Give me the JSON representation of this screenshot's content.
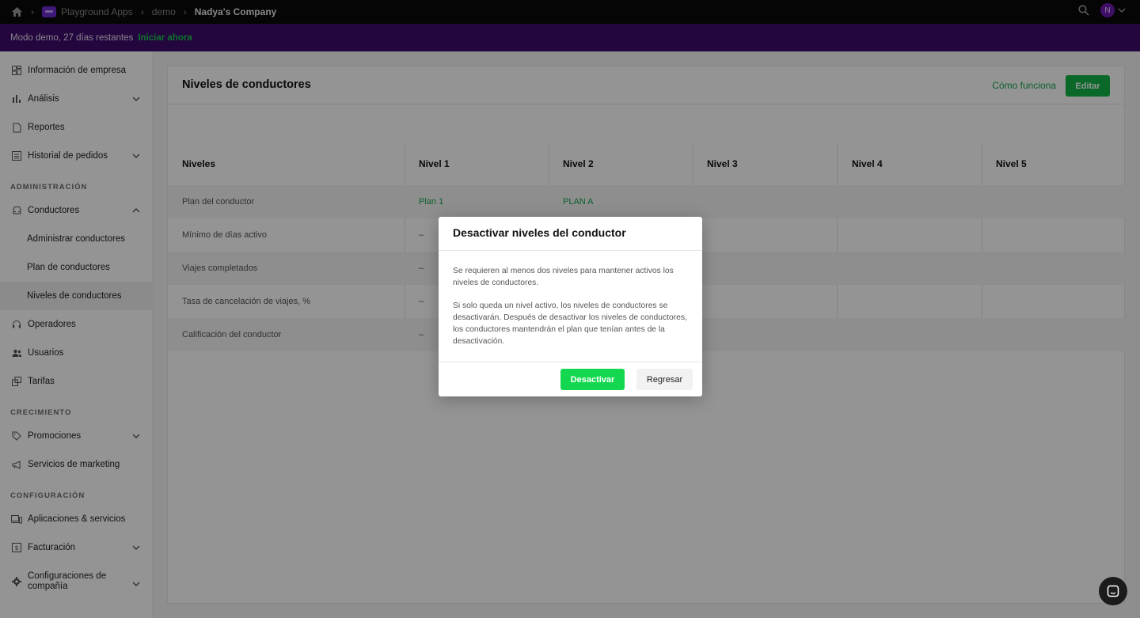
{
  "topbar": {
    "breadcrumb": [
      "Playground Apps",
      "demo",
      "Nadya's Company"
    ],
    "avatar_initial": "N"
  },
  "banner": {
    "text": "Modo demo, 27 días restantes",
    "cta": "Iniciar ahora"
  },
  "sidebar": {
    "items": [
      {
        "label": "Información de empresa"
      },
      {
        "label": "Análisis"
      },
      {
        "label": "Reportes"
      },
      {
        "label": "Historial de pedidos"
      },
      {
        "label": "Conductores"
      },
      {
        "label": "Administrar conductores"
      },
      {
        "label": "Plan de conductores"
      },
      {
        "label": "Niveles de conductores"
      },
      {
        "label": "Operadores"
      },
      {
        "label": "Usuarios"
      },
      {
        "label": "Tarifas"
      },
      {
        "label": "Promociones"
      },
      {
        "label": "Servicios de marketing"
      },
      {
        "label": "Aplicaciones & servicios"
      },
      {
        "label": "Facturación"
      },
      {
        "label": "Configuraciones de compañía"
      }
    ],
    "sections": {
      "admin": "ADMINISTRACIÓN",
      "growth": "CRECIMIENTO",
      "config": "CONFIGURACIÓN"
    }
  },
  "main": {
    "title": "Niveles de conductores",
    "how_link": "Cómo funciona",
    "edit_label": "Editar",
    "table": {
      "headers": [
        "Niveles",
        "Nivel 1",
        "Nivel 2",
        "Nivel 3",
        "Nivel 4",
        "Nivel 5"
      ],
      "rows": [
        {
          "label": "Plan del conductor",
          "n1": "Plan 1",
          "n2": "PLAN A"
        },
        {
          "label": "Mínimo de días activo",
          "n1": "–"
        },
        {
          "label": "Viajes completados",
          "n1": "–"
        },
        {
          "label": "Tasa de cancelación de viajes, %",
          "n1": "–"
        },
        {
          "label": "Calificación del conductor",
          "n1": "–"
        }
      ]
    }
  },
  "modal": {
    "title": "Desactivar niveles del conductor",
    "p1": "Se requieren al menos dos niveles para mantener activos los niveles de conductores.",
    "p2": "Si solo queda un nivel activo, los niveles de conductores se desactivarán. Después de desactivar los niveles de conductores, los conductores mantendrán el plan que tenían antes de la desactivación.",
    "deactivate_label": "Desactivar",
    "back_label": "Regresar"
  },
  "colors": {
    "accent": "#12b546",
    "banner": "#3d0b6b",
    "topbar": "#0a0a0a"
  }
}
